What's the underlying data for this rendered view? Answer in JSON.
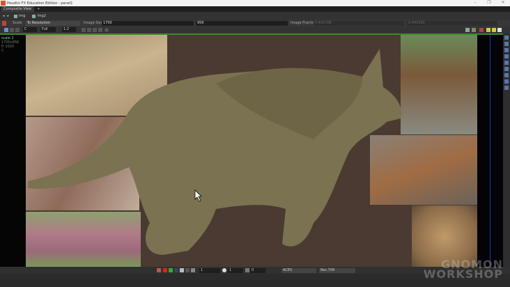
{
  "window": {
    "title": "Houdini FX Education Edition - panel1",
    "min": "–",
    "max": "❐",
    "close": "✕"
  },
  "tabs": [
    {
      "label": "Composite View"
    },
    {
      "label": "+"
    }
  ],
  "nav": {
    "items": [
      {
        "label": "img"
      },
      {
        "label": "img2"
      }
    ]
  },
  "params": {
    "scale_label": "Scale",
    "scale_value": "To Resolution",
    "size_label": "Image Size",
    "width": "1700",
    "height": "956",
    "fraction_label": "Image Fraction",
    "fx": "0.442708",
    "fy": "0.442500"
  },
  "toolbar": {
    "channel": "C",
    "depth": "Full",
    "zoom": "1:2"
  },
  "viewport": {
    "info": [
      "scale 1",
      "1700x956",
      "fr 1020",
      "C"
    ]
  },
  "bottom": {
    "gamma": "1",
    "exposure": "1",
    "offset": "0",
    "colorspace": "ACES",
    "display": "Rec.709"
  },
  "watermark": {
    "line1": "GNOMON",
    "line2": "WORKSHOP"
  },
  "colors": {
    "accent_green": "#3c8a2a",
    "viewport_bg": "#4a3a31"
  }
}
